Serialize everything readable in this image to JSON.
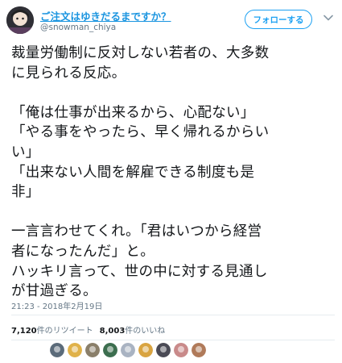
{
  "user": {
    "display_name": "ご注文はゆきだるまですか？",
    "screen_name": "@snowman_chiya"
  },
  "follow_button_label": "フォローする",
  "menu_icon": "chevron-down-icon",
  "tweet": {
    "lines": [
      "裁量労働制に反対しない若者の、大多数",
      "に見られる反応。",
      "",
      "「俺は仕事が出来るから、心配ない」",
      "「やる事をやったら、早く帰れるからい",
      "い」",
      "「出来ない人間を解雇できる制度も是",
      "非」",
      "",
      "一言言わせてくれ。「君はいつから経営",
      "者になったんだ」と。",
      "ハッキリ言って、世の中に対する見通し",
      "が甘過ぎる。"
    ],
    "timestamp": "21:23 - 2018年2月19日"
  },
  "stats": {
    "retweets_count": "7,120",
    "retweets_label": "件のリツイート",
    "likes_count": "8,003",
    "likes_label": "件のいいね"
  },
  "likers": [
    {
      "name": "liker-avatar-1",
      "color": "#5b6b7a"
    },
    {
      "name": "liker-avatar-2",
      "color": "#e0b24a"
    },
    {
      "name": "liker-avatar-3",
      "color": "#8a7f6a"
    },
    {
      "name": "liker-avatar-4",
      "color": "#3c6e4f"
    },
    {
      "name": "liker-avatar-5",
      "color": "#a9b3c2"
    },
    {
      "name": "liker-avatar-6",
      "color": "#d9a441"
    },
    {
      "name": "liker-avatar-7",
      "color": "#4a4a55"
    },
    {
      "name": "liker-avatar-8",
      "color": "#c98a8a"
    },
    {
      "name": "liker-avatar-9",
      "color": "#b07a5a"
    }
  ],
  "colors": {
    "link_blue": "#1b95e0",
    "follow_blue": "#1da1f2",
    "meta_gray": "#657786"
  }
}
